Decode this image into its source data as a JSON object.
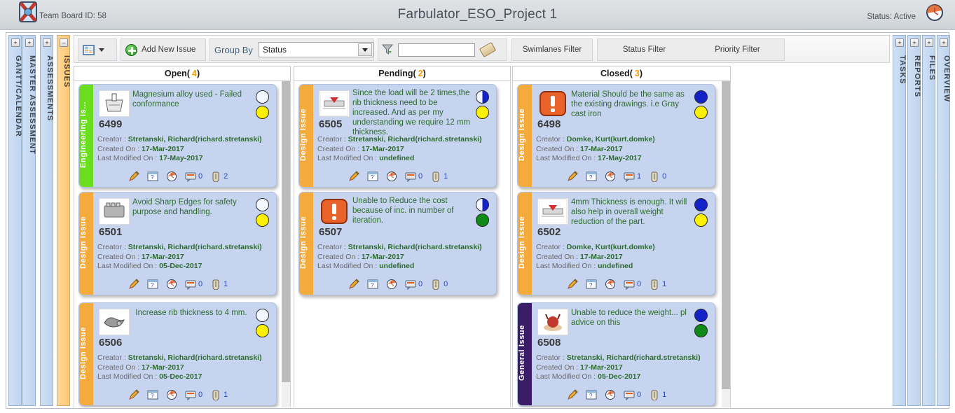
{
  "titlebar": {
    "board_id_label": "Team Board ID: 58",
    "project_title": "Farbulator_ESO_Project 1",
    "status_label": "Status: Active",
    "logo_icon": "team-board-logo-icon",
    "clock_icon": "clock-icon"
  },
  "left_tabs": [
    {
      "label": "GANTT/CALENDAR",
      "expander": "+",
      "active": false
    },
    {
      "label": "MASTER ASSESSMENT",
      "expander": "+",
      "active": false
    },
    {
      "label": "ASSESSMENTS",
      "expander": "+",
      "active": false
    },
    {
      "label": "ISSUES",
      "expander": "–",
      "active": true
    }
  ],
  "right_tabs": [
    {
      "label": "TASKS",
      "expander": "+",
      "active": false
    },
    {
      "label": "REPORTS",
      "expander": "+",
      "active": false
    },
    {
      "label": "FILES",
      "expander": "+",
      "active": false
    },
    {
      "label": "OVERVIEW",
      "expander": "+",
      "active": false
    }
  ],
  "toolbar": {
    "layout_icon": "grid-layout-icon",
    "layout_caret_icon": "chevron-down-icon",
    "add_new_issue_label": "Add New Issue",
    "add_icon": "plus-circle-icon",
    "group_by_label": "Group By",
    "group_by_value": "Status",
    "group_by_caret_icon": "chevron-down-icon",
    "filter_icon": "funnel-icon",
    "search_value": "",
    "search_placeholder": "",
    "clear_icon": "eraser-icon",
    "swimlanes_filter_label": "Swimlanes Filter",
    "status_filter_label": "Status Filter",
    "priority_filter_label": "Priority Filter"
  },
  "columns": [
    {
      "name": "Open",
      "count": "4"
    },
    {
      "name": "Pending",
      "count": "2"
    },
    {
      "name": "Closed",
      "count": "3"
    }
  ],
  "meta_labels": {
    "creator": "Creator : ",
    "created": "Created On : ",
    "modified": "Last Modified On : "
  },
  "colors": {
    "engineering_issue": "#6bdd1f",
    "design_issue": "#f5ab3c",
    "general_issue": "#3a1d66",
    "card_bg": "#c7d4ef",
    "count_accent": "#f59b00",
    "status_blue": "#1322c8",
    "status_yellow": "#fdf000",
    "status_green": "#0f8a16",
    "status_empty": "#f2f6ff"
  },
  "cards": [
    {
      "column": "Open",
      "id": "6499",
      "swimlane": "Engineering Is...",
      "swimlane_color": "#6bdd1f",
      "title": "Magnesium alloy used - Failed conformance",
      "creator": "Stretanski, Richard(richard.stretanski)",
      "created_on": "17-Mar-2017",
      "last_modified_on": "17-May-2017",
      "thumb_icon": "casting-part-thumbnail",
      "dot_top": "empty",
      "dot_bottom": "yellow",
      "comments": "0",
      "attachments": "2",
      "icons": [
        "edit-pencil-icon",
        "checklist-icon",
        "history-clock-icon",
        "comment-icon",
        "attachment-clip-icon"
      ]
    },
    {
      "column": "Open",
      "id": "6501",
      "swimlane": "Design Issue",
      "swimlane_color": "#f5ab3c",
      "title": "Avoid Sharp Edges for safety purpose and handling.",
      "creator": "Stretanski, Richard(richard.stretanski)",
      "created_on": "17-Mar-2017",
      "last_modified_on": "05-Dec-2017",
      "thumb_icon": "engine-block-thumbnail",
      "dot_top": "empty",
      "dot_bottom": "yellow",
      "comments": "0",
      "attachments": "1",
      "icons": [
        "edit-pencil-icon",
        "checklist-icon",
        "history-clock-icon",
        "comment-icon",
        "attachment-clip-icon"
      ]
    },
    {
      "column": "Open",
      "id": "6506",
      "swimlane": "Design Issue",
      "swimlane_color": "#f5ab3c",
      "title": "Increase rib thickness to 4 mm.",
      "creator": "Stretanski, Richard(richard.stretanski)",
      "created_on": "17-Mar-2017",
      "last_modified_on": "05-Dec-2017",
      "thumb_icon": "metal-part-thumbnail",
      "dot_top": "empty",
      "dot_bottom": "yellow",
      "comments": "0",
      "attachments": "1",
      "icons": [
        "edit-pencil-icon",
        "checklist-icon",
        "history-clock-icon",
        "comment-icon",
        "attachment-clip-icon"
      ]
    },
    {
      "column": "Pending",
      "id": "6505",
      "swimlane": "Design Issue",
      "swimlane_color": "#f5ab3c",
      "title": "Since the load will be 2 times,the rib thickness need to be increased. And as per my understanding we require 12 mm thickness.",
      "creator": "Stretanski, Richard(richard.stretanski)",
      "created_on": "17-Mar-2017",
      "last_modified_on": "undefined",
      "thumb_icon": "cad-drawing-thumbnail",
      "dot_top": "half-blue",
      "dot_bottom": "yellow",
      "comments": "0",
      "attachments": "1",
      "icons": [
        "edit-pencil-icon",
        "checklist-icon",
        "history-clock-icon",
        "comment-icon",
        "attachment-clip-icon"
      ]
    },
    {
      "column": "Pending",
      "id": "6507",
      "swimlane": "Design Issue",
      "swimlane_color": "#f5ab3c",
      "title": "Unable to Reduce the cost because of inc. in number of iteration.",
      "creator": "Stretanski, Richard(richard.stretanski)",
      "created_on": "17-Mar-2017",
      "last_modified_on": "undefined",
      "thumb_icon": "exclamation-alert-thumbnail",
      "dot_top": "half-blue",
      "dot_bottom": "green",
      "comments": "0",
      "attachments": "0",
      "icons": [
        "edit-pencil-icon",
        "checklist-icon",
        "history-clock-icon",
        "comment-icon",
        "attachment-clip-icon"
      ]
    },
    {
      "column": "Closed",
      "id": "6498",
      "swimlane": "Design Issue",
      "swimlane_color": "#f5ab3c",
      "title": "Material Should be the same as the existing drawings. i.e Gray cast iron",
      "creator": "Domke, Kurt(kurt.domke)",
      "created_on": "17-Mar-2017",
      "last_modified_on": "17-May-2017",
      "thumb_icon": "exclamation-alert-thumbnail",
      "dot_top": "blue",
      "dot_bottom": "yellow",
      "comments": "1",
      "attachments": "0",
      "icons": [
        "edit-pencil-icon",
        "checklist-icon",
        "history-clock-icon",
        "comment-icon",
        "attachment-clip-icon"
      ]
    },
    {
      "column": "Closed",
      "id": "6502",
      "swimlane": "Design Issue",
      "swimlane_color": "#f5ab3c",
      "title": "4mm Thickness is enough. It will also help in overall weight reduction of the part.",
      "creator": "Domke, Kurt(kurt.domke)",
      "created_on": "17-Mar-2017",
      "last_modified_on": "undefined",
      "thumb_icon": "cad-drawing-thumbnail",
      "dot_top": "blue",
      "dot_bottom": "yellow",
      "comments": "0",
      "attachments": "1",
      "icons": [
        "edit-pencil-icon",
        "checklist-icon",
        "history-clock-icon",
        "comment-icon",
        "attachment-clip-icon"
      ]
    },
    {
      "column": "Closed",
      "id": "6508",
      "swimlane": "General Issue",
      "swimlane_color": "#3a1d66",
      "title": "Unable to reduce the weight... pl advice on this",
      "creator": "Stretanski, Richard(richard.stretanski)",
      "created_on": "17-Mar-2017",
      "last_modified_on": "05-Dec-2017",
      "thumb_icon": "red-object-thumbnail",
      "dot_top": "blue",
      "dot_bottom": "green",
      "comments": "0",
      "attachments": "1",
      "icons": [
        "edit-pencil-icon",
        "checklist-icon",
        "history-clock-icon",
        "comment-icon",
        "attachment-clip-icon"
      ]
    }
  ]
}
